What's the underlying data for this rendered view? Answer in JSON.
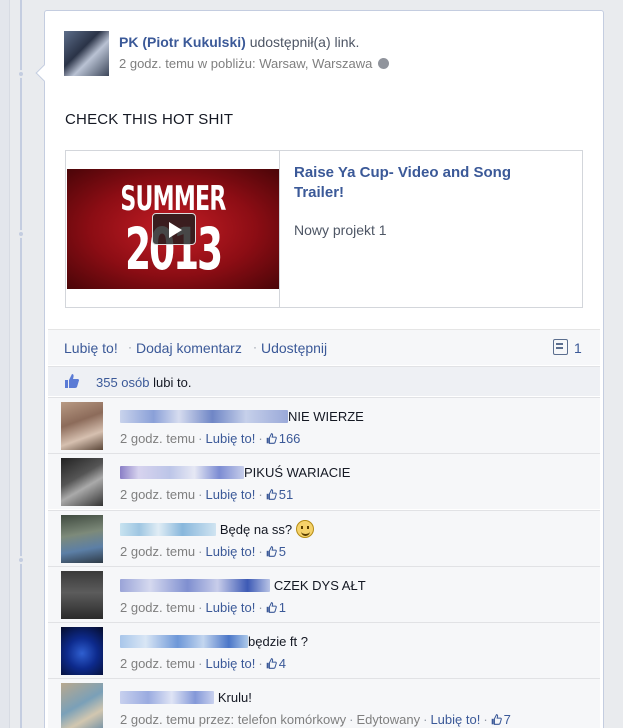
{
  "post": {
    "author": "PK (Piotr Kukulski)",
    "action": "udostępnił(a) link.",
    "meta": "2 godz. temu w pobliżu: Warsaw, Warszawa",
    "status_text": "CHECK THIS HOT SHIT"
  },
  "link_preview": {
    "thumb_line1": "SUMMER",
    "thumb_line2": "2013",
    "title": "Raise Ya Cup- Video and Song Trailer!",
    "subtitle": "Nowy projekt 1"
  },
  "actions": {
    "like": "Lubię to!",
    "comment": "Dodaj komentarz",
    "share": "Udostępnij",
    "separator": "·",
    "comment_count": "1"
  },
  "likes": {
    "count": "355 osób",
    "suffix": "lubi to."
  },
  "comments": [
    {
      "text": "NIE WIERZE",
      "time": "2 godz. temu",
      "like": "Lubię to!",
      "likes": "166",
      "via": ""
    },
    {
      "text": "PIKUŚ WARIACIE",
      "time": "2 godz. temu",
      "like": "Lubię to!",
      "likes": "51",
      "via": ""
    },
    {
      "text": "Będę na ss?",
      "time": "2 godz. temu",
      "like": "Lubię to!",
      "likes": "5",
      "via": ""
    },
    {
      "text": "CZEK DYS AŁT",
      "time": "2 godz. temu",
      "like": "Lubię to!",
      "likes": "1",
      "via": ""
    },
    {
      "text": "będzie ft ?",
      "time": "2 godz. temu",
      "like": "Lubię to!",
      "likes": "4",
      "via": ""
    },
    {
      "text": "Krulu!",
      "time": "2 godz. temu przez: telefon komórkowy",
      "edited": "Edytowany",
      "like": "Lubię to!",
      "likes": "7"
    }
  ],
  "icons": {
    "globe": "globe-icon",
    "play": "play-icon",
    "comment": "comment-icon",
    "thumb": "thumbs-up-icon",
    "smiley": "smiley-emoticon-icon"
  },
  "colors": {
    "link": "#3b5998",
    "meta": "#7f7f7f",
    "comment_bg": "#f6f7f9",
    "thumb_red": "#c41d25"
  }
}
